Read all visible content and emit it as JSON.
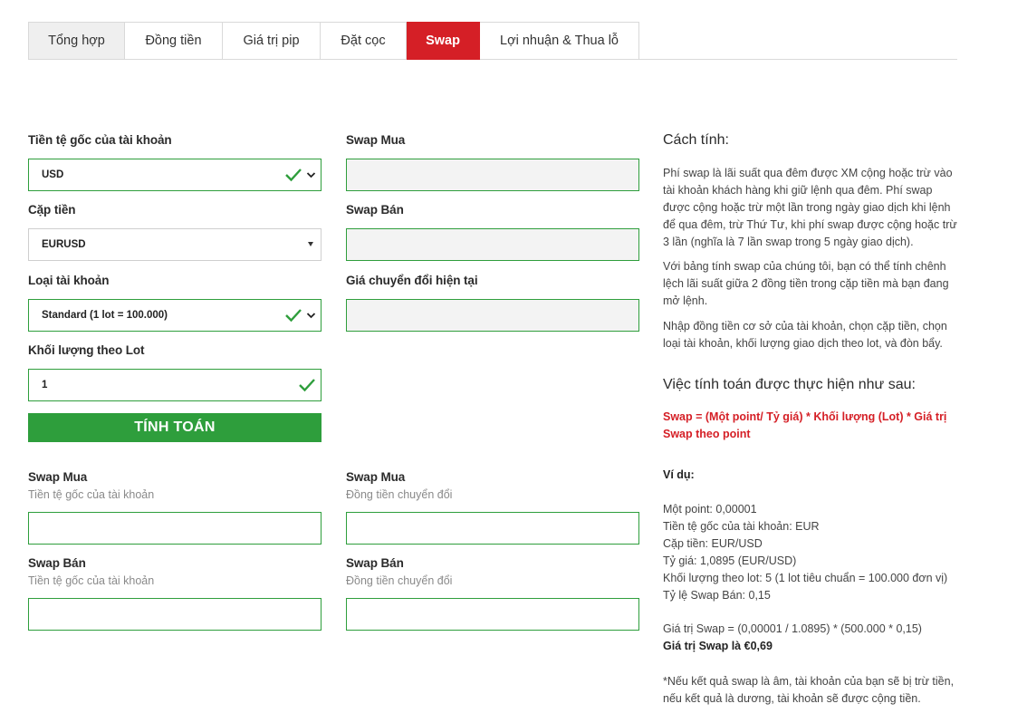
{
  "tabs": [
    {
      "label": "Tổng hợp"
    },
    {
      "label": "Đồng tiền"
    },
    {
      "label": "Giá trị pip"
    },
    {
      "label": "Đặt cọc"
    },
    {
      "label": "Swap"
    },
    {
      "label": "Lợi nhuận & Thua lỗ"
    }
  ],
  "form": {
    "account_currency_label": "Tiền tệ gốc của tài khoản",
    "account_currency_value": "USD",
    "pair_label": "Cặp tiền",
    "pair_value": "EURUSD",
    "account_type_label": "Loại tài khoản",
    "account_type_value": "Standard (1 lot = 100.000)",
    "lot_label": "Khối lượng theo Lot",
    "lot_value": "1",
    "swap_buy_label": "Swap Mua",
    "swap_sell_label": "Swap Bán",
    "conversion_label": "Giá chuyển đổi hiện tại",
    "calculate_button": "TÍNH TOÁN"
  },
  "results": {
    "left_buy_label": "Swap Mua",
    "left_buy_sub": "Tiền tệ gốc của tài khoản",
    "left_sell_label": "Swap Bán",
    "left_sell_sub": "Tiền tệ gốc của tài khoản",
    "right_buy_label": "Swap Mua",
    "right_buy_sub": "Đồng tiền chuyển đổi",
    "right_sell_label": "Swap Bán",
    "right_sell_sub": "Đồng tiền chuyển đổi"
  },
  "info": {
    "heading": "Cách tính:",
    "p1": "Phí swap là lãi suất qua đêm được XM cộng hoặc trừ vào tài khoản khách hàng khi giữ lệnh qua đêm. Phí swap được cộng hoặc trừ một lần trong ngày giao dịch khi lệnh để qua đêm, trừ Thứ Tư, khi phí swap được cộng hoặc trừ 3 lần (nghĩa là 7 lần swap trong 5 ngày giao dịch).",
    "p2": "Với bảng tính swap của chúng tôi, bạn có thể tính chênh lệch lãi suất giữa 2 đồng tiền trong cặp tiền mà bạn đang mở lệnh.",
    "p3": "Nhập đồng tiền cơ sở của tài khoản, chọn cặp tiền, chọn loại tài khoản, khối lượng giao dịch theo lot, và đòn bẩy.",
    "heading2": "Việc tính toán được thực hiện như sau:",
    "formula": "Swap = (Một point/ Tỷ giá) * Khối lượng (Lot) * Giá trị Swap theo point",
    "example_label": "Ví dụ:",
    "ex1": "Một point: 0,00001",
    "ex2": "Tiền tệ gốc của tài khoản: EUR",
    "ex3": "Cặp tiền: EUR/USD",
    "ex4": "Tỷ giá: 1,0895 (EUR/USD)",
    "ex5": "Khối lượng theo lot: 5 (1 lot tiêu chuẩn = 100.000 đơn vị)",
    "ex6": "Tỷ lệ Swap Bán: 0,15",
    "ex7": "Giá trị Swap = (0,00001 / 1.0895) * (500.000 * 0,15)",
    "ex8": "Giá trị Swap là €0,69",
    "note": "*Nếu kết quả swap là âm, tài khoản của bạn sẽ bị trừ tiền, nếu kết quả là dương, tài khoản sẽ được cộng tiền."
  },
  "colors": {
    "accent_red": "#d51f26",
    "accent_green": "#2e9e3c"
  }
}
